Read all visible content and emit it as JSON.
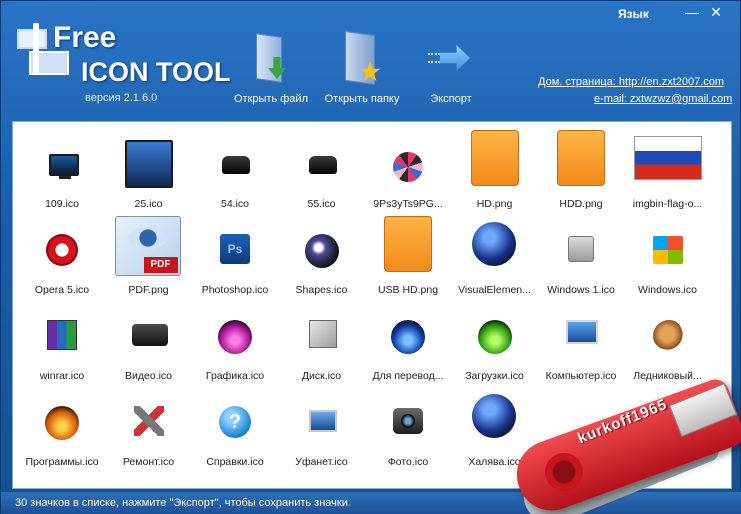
{
  "app": {
    "logo_line1": "Free",
    "logo_line2": "ICON TOOL",
    "version": "версия 2.1.6.0",
    "language_menu": "Язык",
    "minimize": "—",
    "close": "✕"
  },
  "toolbar": {
    "open_file": "Открыть файл",
    "open_folder": "Открыть папку",
    "export": "Экспорт"
  },
  "links": {
    "homepage": "Дом. страница: http://en.zxt2007.com",
    "email": "e-mail: zxtwzwz@gmail.com"
  },
  "icons": [
    {
      "label": "109.ico",
      "kind": "tv"
    },
    {
      "label": "25.ico",
      "kind": "tv2"
    },
    {
      "label": "54.ico",
      "kind": "car"
    },
    {
      "label": "55.ico",
      "kind": "car"
    },
    {
      "label": "9Ps3yTs9PG...",
      "kind": "collage"
    },
    {
      "label": "HD.png",
      "kind": "hdd-orange"
    },
    {
      "label": "HDD.png",
      "kind": "hdd-orange"
    },
    {
      "label": "imgbin-flag-o...",
      "kind": "flag"
    },
    {
      "label": "Opera 5.ico",
      "kind": "opera"
    },
    {
      "label": "PDF.png",
      "kind": "pdf"
    },
    {
      "label": "Photoshop.ico",
      "kind": "ps"
    },
    {
      "label": "Shapes.ico",
      "kind": "orb-shapes"
    },
    {
      "label": "USB HD.png",
      "kind": "hdd-orange"
    },
    {
      "label": "VisualElemen...",
      "kind": "globe"
    },
    {
      "label": "Windows 1.ico",
      "kind": "gray-hdd"
    },
    {
      "label": "Windows.ico",
      "kind": "winlogo"
    },
    {
      "label": "winrar.ico",
      "kind": "winrar"
    },
    {
      "label": "Видео.ico",
      "kind": "camera"
    },
    {
      "label": "Графика.ico",
      "kind": "orb-pink"
    },
    {
      "label": "Диск.ico",
      "kind": "disk"
    },
    {
      "label": "Для перевод...",
      "kind": "orb-deepblue"
    },
    {
      "label": "Загрузки.ico",
      "kind": "orb-green"
    },
    {
      "label": "Компьютер.ico",
      "kind": "monitor"
    },
    {
      "label": "Ледниковый...",
      "kind": "squirrel"
    },
    {
      "label": "Программы.ico",
      "kind": "orb-orange"
    },
    {
      "label": "Ремонт.ico",
      "kind": "tools"
    },
    {
      "label": "Справки.ico",
      "kind": "help"
    },
    {
      "label": "Уфанет.ico",
      "kind": "netpc"
    },
    {
      "label": "Фото.ico",
      "kind": "photo"
    },
    {
      "label": "Халява.ico",
      "kind": "globe"
    }
  ],
  "status": "30 значков в списке, нажмите \"Экспорт\", чтобы сохранить значки.",
  "overlay": {
    "usb_text": "kurkoff1965"
  },
  "colors": {
    "titlebar": "#1b5ea9",
    "panel_bg": "#ffffff",
    "usb_red": "#d11a22"
  }
}
